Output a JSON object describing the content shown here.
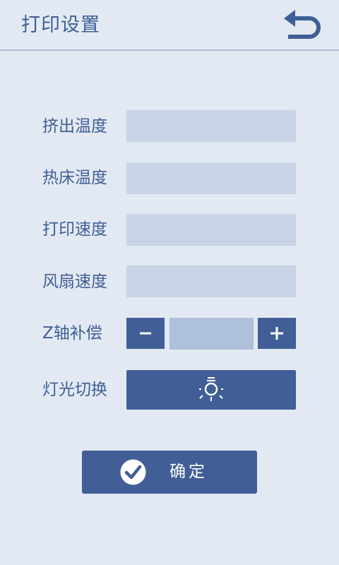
{
  "header": {
    "title": "打印设置",
    "back_icon": "back-arrow-icon"
  },
  "settings": {
    "extrude_temp": {
      "label": "挤出温度",
      "value": ""
    },
    "bed_temp": {
      "label": "热床温度",
      "value": ""
    },
    "print_speed": {
      "label": "打印速度",
      "value": ""
    },
    "fan_speed": {
      "label": "风扇速度",
      "value": ""
    },
    "z_offset": {
      "label": "Z轴补偿",
      "value": "",
      "minus": "−",
      "plus": "+"
    },
    "light": {
      "label": "灯光切换",
      "icon": "lightbulb-icon"
    }
  },
  "confirm": {
    "label": "确定",
    "icon": "check-circle-icon"
  },
  "colors": {
    "background": "#e3e9f3",
    "accent": "#415f96",
    "field": "#c9d3e6",
    "text": "#3f5f95"
  }
}
